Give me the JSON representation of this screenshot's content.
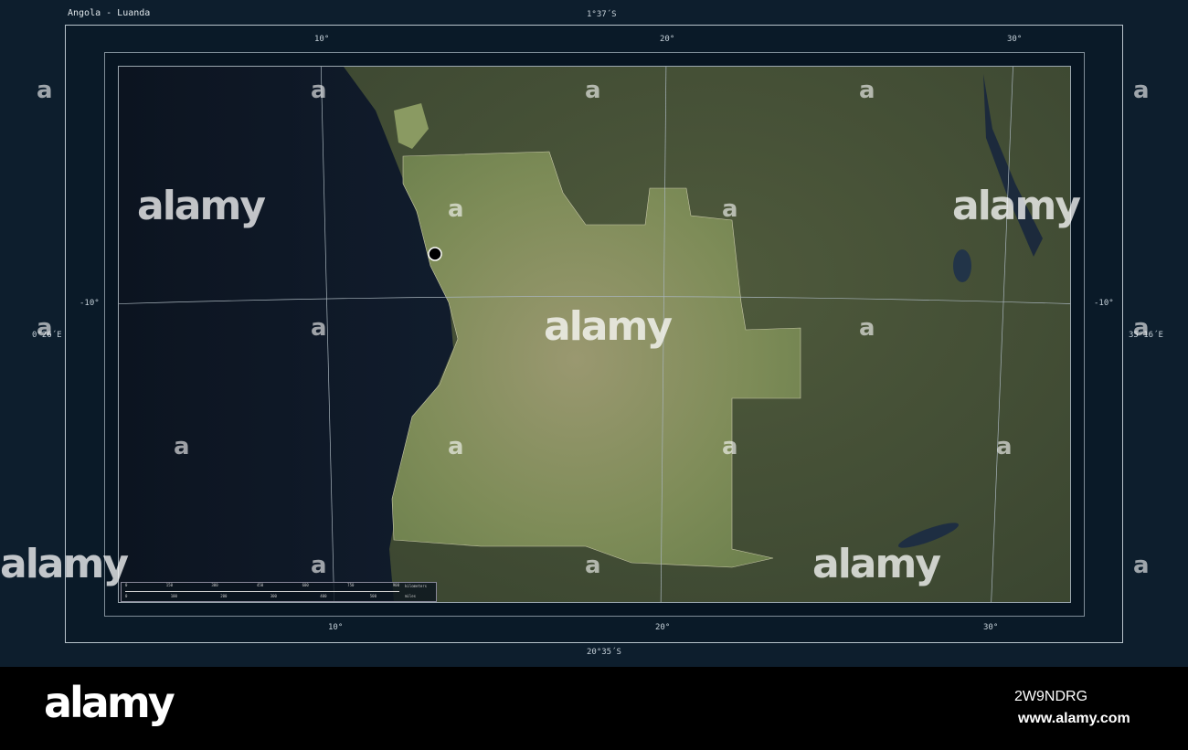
{
  "title": "Angola - Luanda",
  "top_coordinate": "1°37´S",
  "bottom_coordinate": "20°35´S",
  "left_coordinate": "0°26´E",
  "right_coordinate": "35°16´E",
  "lon_labels_top": [
    "10°",
    "20°",
    "30°"
  ],
  "lon_labels_bottom": [
    "10°",
    "20°",
    "30°"
  ],
  "lat_labels": {
    "left": "-10°",
    "right": "-10°"
  },
  "scale_bar": {
    "km_ticks": [
      "0",
      "150",
      "300",
      "450",
      "600",
      "750",
      "900"
    ],
    "km_unit": "kilometers",
    "mi_ticks": [
      "0",
      "100",
      "200",
      "300",
      "400",
      "500"
    ],
    "mi_unit": "miles"
  },
  "marker": {
    "name": "Luanda"
  },
  "watermark": {
    "text": "alamy",
    "small": "a"
  },
  "footer": {
    "logo": "alamy",
    "image_id": "2W9NDRG",
    "url": "www.alamy.com"
  },
  "colors": {
    "ocean": "#0a1828",
    "land": "#4a5a3a",
    "angola": "#7c8a5c",
    "frame": "#0d1e2d"
  }
}
